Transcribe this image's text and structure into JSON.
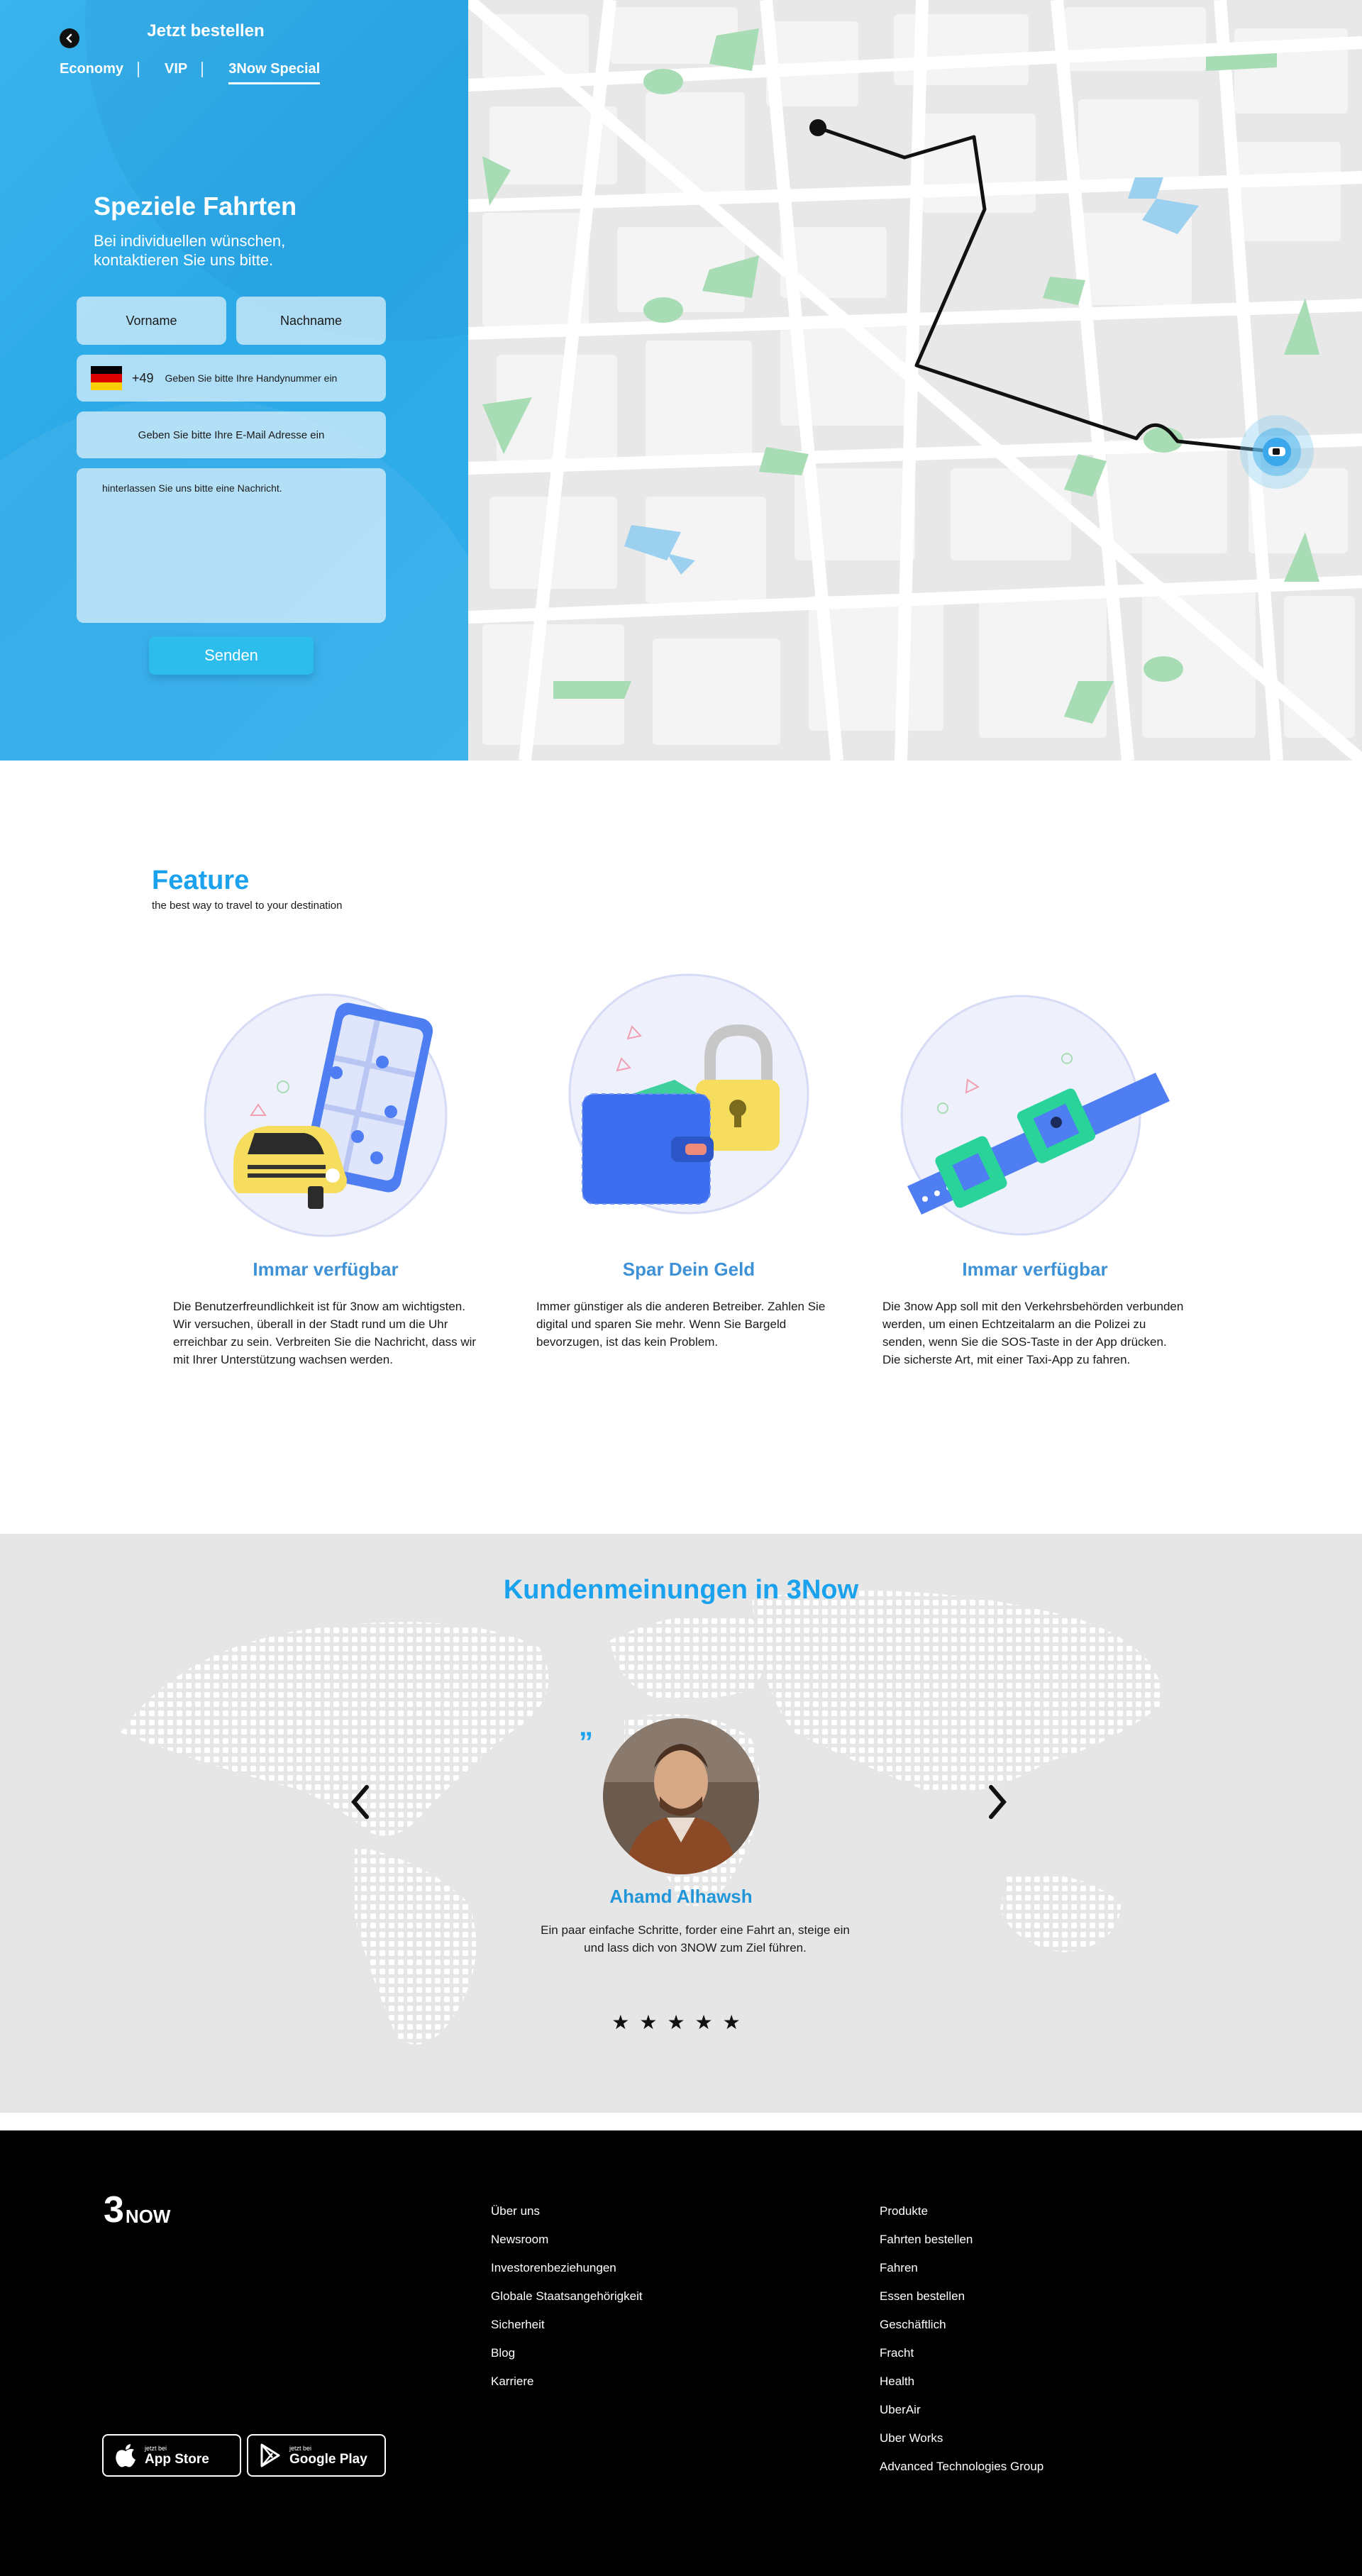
{
  "header": {
    "title": "Jetzt bestellen",
    "tabs": [
      {
        "label": "Economy",
        "active": false
      },
      {
        "label": "VIP",
        "active": false
      },
      {
        "label": "3Now Special",
        "active": true
      }
    ]
  },
  "form": {
    "title": "Speziele Fahrten",
    "subtitle": "Bei individuellen wünschen, kontaktieren Sie uns bitte.",
    "first_name_placeholder": "Vorname",
    "last_name_placeholder": "Nachname",
    "dial_code": "+49",
    "phone_placeholder": "Geben Sie bitte Ihre Handynummer ein",
    "email_placeholder": "Geben Sie bitte Ihre E-Mail Adresse ein",
    "message_placeholder": "hinterlassen Sie uns bitte eine Nachricht.",
    "submit_label": "Senden"
  },
  "features": {
    "title": "Feature",
    "subtitle": "the best way to travel to your destination",
    "items": [
      {
        "title": "Immar verfügbar",
        "icon": "taxi-map-icon",
        "text": "Die Benutzerfreundlichkeit ist für 3now am wichtigsten. Wir versuchen, überall in der Stadt rund um die Uhr erreichbar zu sein. Verbreiten Sie die Nachricht, dass wir mit Ihrer Unterstützung wachsen werden."
      },
      {
        "title": "Spar Dein Geld",
        "icon": "wallet-lock-icon",
        "text": "Immer günstiger als die anderen Betreiber. Zahlen Sie digital und sparen Sie mehr. Wenn Sie Bargeld bevorzugen, ist das kein Problem."
      },
      {
        "title": "Immar verfügbar",
        "icon": "seatbelt-icon",
        "text": "Die 3now App soll mit den Verkehrsbehörden verbunden werden, um einen Echtzeitalarm an die Polizei zu senden, wenn Sie die SOS-Taste in der App drücken. Die sicherste Art, mit einer Taxi-App zu fahren."
      }
    ]
  },
  "testimonials": {
    "title": "Kundenmeinungen in 3Now",
    "name": "Ahamd Alhawsh",
    "quote": "Ein paar einfache Schritte, forder eine Fahrt an, steige ein und lass dich von 3NOW zum Ziel führen.",
    "quote_mark": "”",
    "stars": "★★★★★",
    "rating": 5
  },
  "footer": {
    "logo_main": "3",
    "logo_suffix": "NOW",
    "col1": [
      "Über uns",
      "Newsroom",
      "Investorenbeziehungen",
      "Globale Staatsangehörigkeit",
      "Sicherheit",
      "Blog",
      "Karriere"
    ],
    "col2": [
      "Produkte",
      "Fahrten bestellen",
      "Fahren",
      "Essen bestellen",
      "Geschäftlich",
      "Fracht",
      "Health",
      "UberAir",
      "Uber Works",
      "Advanced Technologies Group"
    ],
    "app_store": {
      "small": "jetzt bei",
      "big": "App Store"
    },
    "google_play": {
      "small": "jetzt bei",
      "big": "Google Play"
    }
  },
  "colors": {
    "accent": "#1aa2ee",
    "panel": "#31aeea",
    "route": "#111111",
    "park": "#a8dcb4"
  }
}
